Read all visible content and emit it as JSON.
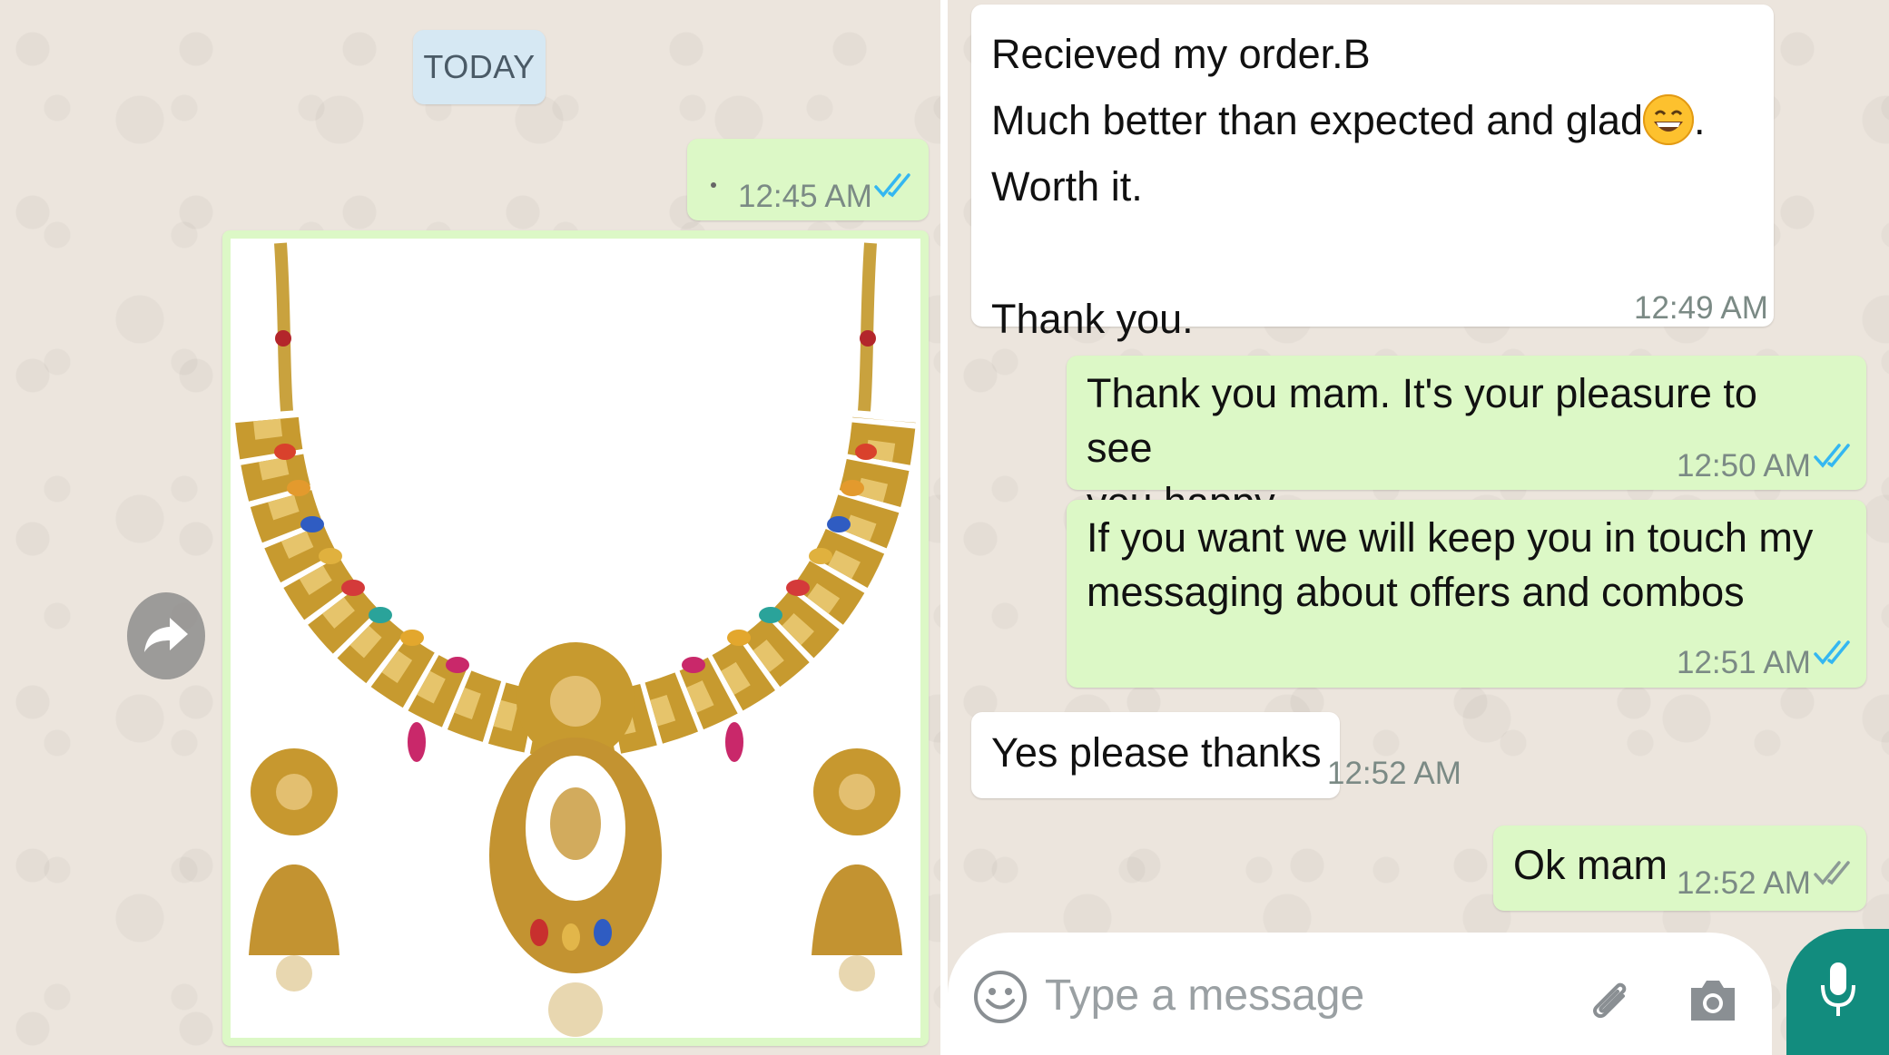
{
  "left": {
    "date_chip": "TODAY",
    "first_message": {
      "time": "12:45 AM"
    }
  },
  "right": {
    "messages": [
      {
        "lines": [
          "Recieved my order.B",
          "Much better than expected and glad",
          ".",
          "Worth it.",
          "",
          "Thank you."
        ],
        "time": "12:49 AM"
      },
      {
        "text": "Thank you mam. It's your pleasure to see you happy.",
        "lines": [
          "Thank you mam. It's your pleasure to see",
          "you happy."
        ],
        "time": "12:50 AM"
      },
      {
        "lines": [
          "If you want we will keep you in touch my",
          "messaging about offers and combos"
        ],
        "time": "12:51 AM"
      },
      {
        "text": "Yes please thanks",
        "time": "12:52 AM"
      },
      {
        "text": "Ok mam",
        "time": "12:52 AM"
      }
    ],
    "composer": {
      "placeholder": "Type a message"
    }
  },
  "icons": {
    "forward": "forward-arrow-icon",
    "emoji": "smiley-icon",
    "attach": "paperclip-icon",
    "camera": "camera-icon",
    "mic": "microphone-icon",
    "read": "double-check-icon"
  },
  "colors": {
    "outgoing_bubble": "#dcf8c6",
    "incoming_bubble": "#ffffff",
    "read_tick": "#34b7f1",
    "accent": "#128c7e"
  }
}
